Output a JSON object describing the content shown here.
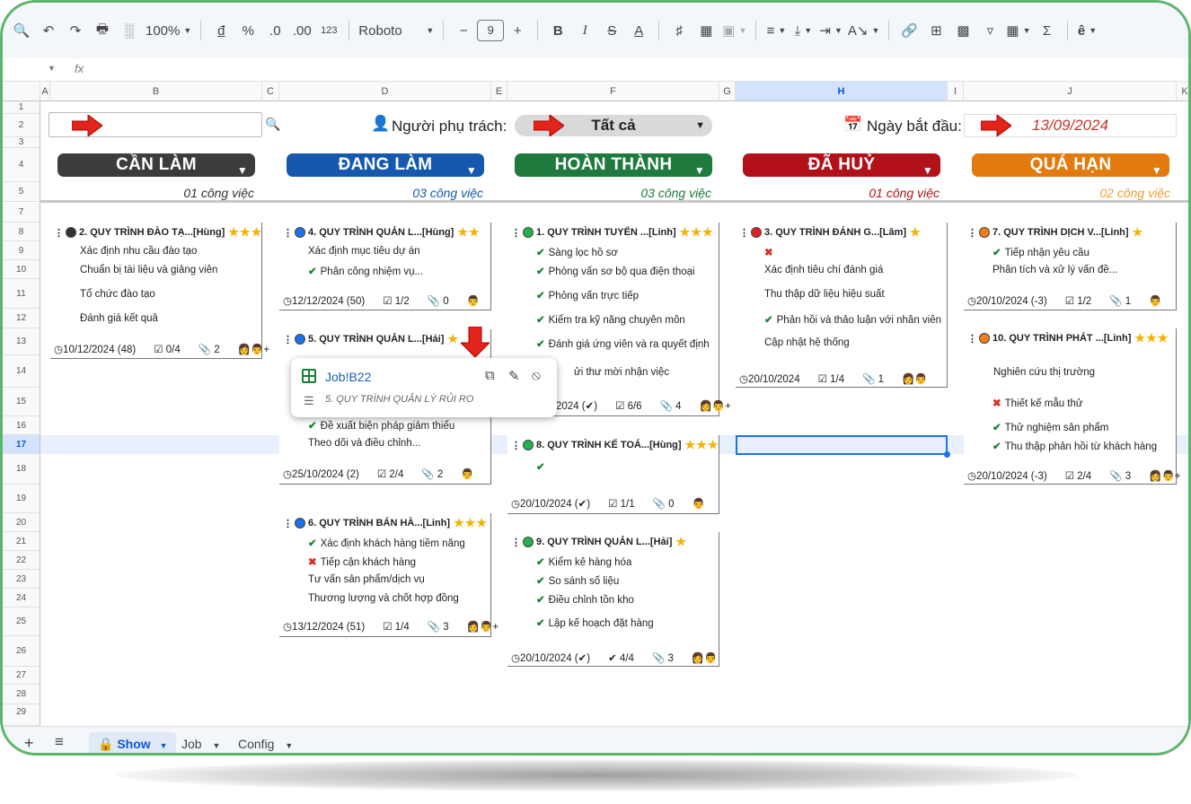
{
  "toolbar": {
    "zoom": "100%",
    "currency": "đ",
    "percent": "%",
    "dec_down": ".0",
    "dec_up": ".00",
    "format_num": "123",
    "font": "Roboto",
    "font_size": "9",
    "text_color": "A"
  },
  "formula_bar": {
    "fx": "fx"
  },
  "columns": [
    "A",
    "B",
    "C",
    "D",
    "E",
    "F",
    "G",
    "H",
    "I",
    "J",
    "K"
  ],
  "rows": [
    "1",
    "2",
    "3",
    "4",
    "5",
    "7",
    "8",
    "9",
    "10",
    "11",
    "12",
    "13",
    "14",
    "15",
    "16",
    "17",
    "18",
    "19",
    "20",
    "21",
    "22",
    "23",
    "24",
    "25",
    "26",
    "27",
    "28",
    "29"
  ],
  "filters": {
    "person_label": "Người phụ trách:",
    "person_value": "Tất cả",
    "date_label": "Ngày bắt đầu:",
    "date_value": "13/09/2024"
  },
  "columns_kanban": [
    {
      "title": "CẦN LÀM",
      "count": "01 công việc",
      "color": "#3c3c3c",
      "count_color": "#333333"
    },
    {
      "title": "ĐANG LÀM",
      "count": "03 công việc",
      "color": "#1558b0",
      "count_color": "#1558b0"
    },
    {
      "title": "HOÀN THÀNH",
      "count": "03 công việc",
      "color": "#1e7a3d",
      "count_color": "#1e7a3d"
    },
    {
      "title": "ĐÃ HUỶ",
      "count": "01 công việc",
      "color": "#b3111a",
      "count_color": "#b3111a"
    },
    {
      "title": "QUÁ HẠN",
      "count": "02 công việc",
      "color": "#e37a0e",
      "count_color": "#f0a030"
    }
  ],
  "cards": [
    {
      "title": "2. QUY TRÌNH ĐÀO TẠ...[Hùng]",
      "stars": "★★★",
      "dot": "#333333",
      "tasks": [
        {
          "t": "Xác định nhu cầu đào tạo",
          "s": ""
        },
        {
          "t": "Chuẩn bị tài liệu và giảng viên",
          "s": ""
        },
        {
          "t": "Tổ chức đào tạo",
          "s": ""
        },
        {
          "t": "Đánh giá kết quả",
          "s": ""
        }
      ],
      "meta": {
        "date": "10/12/2024 (48)",
        "todo": "0/4",
        "attach": "2"
      }
    },
    {
      "title": "4. QUY TRÌNH QUẢN L...[Hùng]",
      "stars": "★★",
      "dot": "#1a73e8",
      "tasks": [
        {
          "t": "Xác định mục tiêu dự án",
          "s": ""
        },
        {
          "t": "Phân công nhiệm vụ...",
          "s": "ok"
        }
      ],
      "meta": {
        "date": "12/12/2024 (50)",
        "todo": "1/2",
        "attach": "0"
      }
    },
    {
      "title": "5. QUY TRÌNH QUẢN L...[Hải]",
      "stars": "★",
      "dot": "#1a73e8",
      "tasks": [
        {
          "t": "Đề xuất biện pháp giảm thiểu",
          "s": "ok"
        },
        {
          "t": "Theo dõi và điều chỉnh...",
          "s": ""
        }
      ],
      "meta": {
        "date": "25/10/2024 (2)",
        "todo": "2/4",
        "attach": "2"
      }
    },
    {
      "title": "6. QUY TRÌNH BÁN HÀ...[Linh]",
      "stars": "★★★",
      "dot": "#1a73e8",
      "tasks": [
        {
          "t": "Xác định khách hàng tiềm năng",
          "s": "ok"
        },
        {
          "t": "Tiếp cận khách hàng",
          "s": "x"
        },
        {
          "t": "Tư vấn sản phẩm/dịch vụ",
          "s": ""
        },
        {
          "t": "Thương lượng và chốt hợp đồng",
          "s": ""
        }
      ],
      "meta": {
        "date": "13/12/2024 (51)",
        "todo": "1/4",
        "attach": "3"
      }
    },
    {
      "title": "1. QUY TRÌNH TUYỂN ...[Linh]",
      "stars": "★★★",
      "dot": "#22b14c",
      "tasks": [
        {
          "t": "Sàng lọc hồ sơ",
          "s": "ok"
        },
        {
          "t": "Phỏng vấn sơ bộ qua điện thoại",
          "s": "ok"
        },
        {
          "t": "Phỏng vấn trực tiếp",
          "s": "ok"
        },
        {
          "t": "Kiểm tra kỹ năng chuyên môn",
          "s": "ok"
        },
        {
          "t": "Đánh giá ứng viên và ra quyết định",
          "s": "ok"
        },
        {
          "t": "ửi thư mời nhận việc",
          "s": ""
        }
      ],
      "meta": {
        "date": "2024 (✔)",
        "todo": "6/6",
        "attach": "4"
      }
    },
    {
      "title": "8. QUY TRÌNH KẾ TOÁ...[Hùng]",
      "stars": "★★★",
      "dot": "#22b14c",
      "tasks": [
        {
          "t": "",
          "s": "ok"
        }
      ],
      "meta": {
        "date": "20/10/2024 (✔)",
        "todo": "1/1",
        "attach": "0"
      }
    },
    {
      "title": "9. QUY TRÌNH QUẢN L...[Hải]",
      "stars": "★",
      "dot": "#22b14c",
      "tasks": [
        {
          "t": "Kiểm kê hàng hóa",
          "s": "ok"
        },
        {
          "t": "So sánh số liệu",
          "s": "ok"
        },
        {
          "t": "Điều chỉnh tồn kho",
          "s": "ok"
        },
        {
          "t": "Lập kế hoạch đặt hàng",
          "s": "ok"
        }
      ],
      "meta": {
        "date": "20/10/2024 (✔)",
        "todo": "4/4",
        "attach": "3"
      }
    },
    {
      "title": "3. QUY TRÌNH ĐÁNH G...[Lâm]",
      "stars": "★",
      "dot": "#e02020",
      "tasks": [
        {
          "t": "",
          "s": "x"
        },
        {
          "t": "Xác định tiêu chí đánh giá",
          "s": ""
        },
        {
          "t": "Thu thập dữ liệu hiệu suất",
          "s": ""
        },
        {
          "t": "Phản hồi và thảo luận với nhân viên",
          "s": "ok"
        },
        {
          "t": "Cập nhật hệ thống",
          "s": ""
        }
      ],
      "meta": {
        "date": "20/10/2024",
        "todo": "1/4",
        "attach": "1"
      }
    },
    {
      "title": "7. QUY TRÌNH DỊCH V...[Linh]",
      "stars": "★",
      "dot": "#f07c1a",
      "tasks": [
        {
          "t": "Tiếp nhận yêu cầu",
          "s": "ok"
        },
        {
          "t": "Phân tích và xử lý vấn đề...",
          "s": ""
        }
      ],
      "meta": {
        "date": "20/10/2024 (-3)",
        "todo": "1/2",
        "attach": "1"
      }
    },
    {
      "title": "10. QUY TRÌNH PHÁT ...[Linh]",
      "stars": "★★★",
      "dot": "#f07c1a",
      "tasks": [
        {
          "t": "Nghiên cứu thị trường",
          "s": ""
        },
        {
          "t": "Thiết kế mẫu thử",
          "s": "x"
        },
        {
          "t": "Thử nghiệm sản phẩm",
          "s": "ok"
        },
        {
          "t": "Thu thập phản hồi từ khách hàng",
          "s": "ok"
        }
      ],
      "meta": {
        "date": "20/10/2024 (-3)",
        "todo": "2/4",
        "attach": "3"
      }
    }
  ],
  "popup": {
    "ref": "Job!B22",
    "subtitle": "5. QUY TRÌNH QUẢN LÝ RỦI RO"
  },
  "sheets": [
    {
      "name": "Show",
      "active": true
    },
    {
      "name": "Job",
      "active": false
    },
    {
      "name": "Config",
      "active": false
    }
  ]
}
